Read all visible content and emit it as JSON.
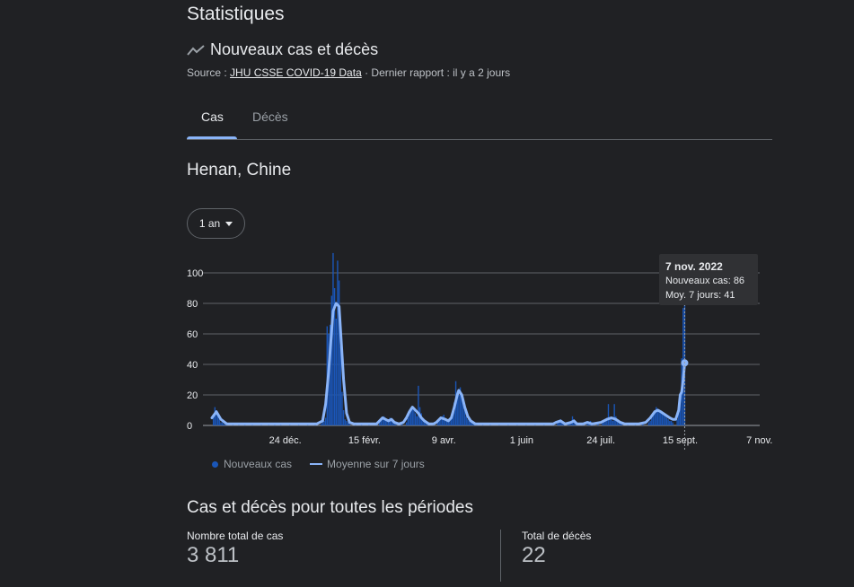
{
  "header": {
    "title": "Statistiques",
    "subtitle": "Nouveaux cas et décès",
    "source_prefix": "Source : ",
    "source_link": "JHU CSSE COVID-19 Data",
    "source_suffix": " · Dernier rapport : il y a 2 jours"
  },
  "tabs": [
    {
      "label": "Cas",
      "selected": true
    },
    {
      "label": "Décès",
      "selected": false
    }
  ],
  "region": "Henan, Chine",
  "period_selector": "1 an",
  "tooltip": {
    "date": "7 nov. 2022",
    "cases_line": "Nouveaux cas: 86",
    "avg_line": "Moy. 7 jours: 41"
  },
  "legend": {
    "cases": "Nouveaux cas",
    "average": "Moyenne sur 7 jours"
  },
  "totals": {
    "title": "Cas et décès pour toutes les périodes",
    "cases_label": "Nombre total de cas",
    "cases_value": "3 811",
    "deaths_label": "Total de décès",
    "deaths_value": "22"
  },
  "colors": {
    "background": "#202124",
    "bar": "#1a56b8",
    "average_line": "#8ab4f8",
    "accent": "#8ab4f8"
  },
  "chart_data": {
    "type": "bar",
    "title": "",
    "xlabel": "",
    "ylabel": "",
    "ylim": [
      0,
      110
    ],
    "yticks": [
      0,
      20,
      40,
      60,
      80,
      100
    ],
    "xtick_labels": [
      "24 déc.",
      "15 févr.",
      "9 avr.",
      "1 juin",
      "24 juil.",
      "15 sept.",
      "7 nov."
    ],
    "xtick_day_index": [
      49,
      102,
      155,
      207,
      260,
      313,
      366
    ],
    "grid": true,
    "legend_position": "bottom",
    "series": [
      {
        "name": "Nouveaux cas",
        "kind": "bar",
        "points": [
          [
            1,
            6
          ],
          [
            2,
            12
          ],
          [
            3,
            10
          ],
          [
            4,
            7
          ],
          [
            5,
            4
          ],
          [
            6,
            2
          ],
          [
            7,
            2
          ],
          [
            8,
            1
          ],
          [
            9,
            1
          ],
          [
            10,
            1
          ],
          [
            14,
            1
          ],
          [
            18,
            1
          ],
          [
            22,
            1
          ],
          [
            27,
            1
          ],
          [
            33,
            1
          ],
          [
            38,
            1
          ],
          [
            42,
            1
          ],
          [
            46,
            1
          ],
          [
            52,
            1
          ],
          [
            58,
            1
          ],
          [
            64,
            1
          ],
          [
            69,
            1
          ],
          [
            73,
            1
          ],
          [
            74,
            2
          ],
          [
            75,
            3
          ],
          [
            76,
            5
          ],
          [
            77,
            65
          ],
          [
            78,
            60
          ],
          [
            79,
            66
          ],
          [
            80,
            85
          ],
          [
            81,
            113
          ],
          [
            82,
            90
          ],
          [
            83,
            70
          ],
          [
            84,
            108
          ],
          [
            85,
            95
          ],
          [
            86,
            52
          ],
          [
            87,
            22
          ],
          [
            88,
            10
          ],
          [
            89,
            4
          ],
          [
            90,
            3
          ],
          [
            91,
            2
          ],
          [
            92,
            1
          ],
          [
            96,
            1
          ],
          [
            100,
            1
          ],
          [
            105,
            1
          ],
          [
            110,
            1
          ],
          [
            112,
            2
          ],
          [
            113,
            3
          ],
          [
            114,
            4
          ],
          [
            115,
            6
          ],
          [
            116,
            5
          ],
          [
            117,
            4
          ],
          [
            118,
            3
          ],
          [
            119,
            5
          ],
          [
            120,
            4
          ],
          [
            121,
            3
          ],
          [
            122,
            2
          ],
          [
            123,
            1
          ],
          [
            127,
            1
          ],
          [
            130,
            2
          ],
          [
            131,
            5
          ],
          [
            132,
            8
          ],
          [
            133,
            10
          ],
          [
            134,
            12
          ],
          [
            135,
            10
          ],
          [
            136,
            8
          ],
          [
            137,
            6
          ],
          [
            138,
            26
          ],
          [
            139,
            12
          ],
          [
            140,
            8
          ],
          [
            141,
            5
          ],
          [
            142,
            3
          ],
          [
            143,
            2
          ],
          [
            144,
            1
          ],
          [
            148,
            1
          ],
          [
            151,
            2
          ],
          [
            152,
            3
          ],
          [
            153,
            5
          ],
          [
            154,
            6
          ],
          [
            155,
            7
          ],
          [
            156,
            5
          ],
          [
            157,
            4
          ],
          [
            158,
            3
          ],
          [
            159,
            4
          ],
          [
            160,
            5
          ],
          [
            161,
            8
          ],
          [
            162,
            15
          ],
          [
            163,
            29
          ],
          [
            164,
            22
          ],
          [
            165,
            20
          ],
          [
            166,
            25
          ],
          [
            167,
            18
          ],
          [
            168,
            15
          ],
          [
            169,
            10
          ],
          [
            170,
            6
          ],
          [
            171,
            4
          ],
          [
            172,
            3
          ],
          [
            173,
            2
          ],
          [
            174,
            2
          ],
          [
            175,
            1
          ],
          [
            176,
            2
          ],
          [
            177,
            1
          ],
          [
            181,
            1
          ],
          [
            186,
            1
          ],
          [
            192,
            1
          ],
          [
            198,
            1
          ],
          [
            204,
            1
          ],
          [
            210,
            1
          ],
          [
            216,
            1
          ],
          [
            222,
            1
          ],
          [
            228,
            1
          ],
          [
            231,
            2
          ],
          [
            232,
            3
          ],
          [
            233,
            4
          ],
          [
            234,
            2
          ],
          [
            235,
            1
          ],
          [
            238,
            1
          ],
          [
            239,
            2
          ],
          [
            240,
            3
          ],
          [
            241,
            6
          ],
          [
            242,
            4
          ],
          [
            243,
            2
          ],
          [
            244,
            1
          ],
          [
            248,
            1
          ],
          [
            251,
            1
          ],
          [
            252,
            2
          ],
          [
            253,
            3
          ],
          [
            254,
            2
          ],
          [
            255,
            1
          ],
          [
            258,
            1
          ],
          [
            261,
            2
          ],
          [
            262,
            3
          ],
          [
            263,
            4
          ],
          [
            264,
            5
          ],
          [
            265,
            14
          ],
          [
            266,
            5
          ],
          [
            267,
            4
          ],
          [
            268,
            3
          ],
          [
            269,
            14
          ],
          [
            270,
            6
          ],
          [
            271,
            4
          ],
          [
            272,
            2
          ],
          [
            273,
            2
          ],
          [
            274,
            1
          ],
          [
            278,
            1
          ],
          [
            283,
            1
          ],
          [
            288,
            1
          ],
          [
            292,
            2
          ],
          [
            293,
            3
          ],
          [
            294,
            5
          ],
          [
            295,
            8
          ],
          [
            296,
            10
          ],
          [
            297,
            12
          ],
          [
            298,
            11
          ],
          [
            299,
            10
          ],
          [
            300,
            9
          ],
          [
            301,
            8
          ],
          [
            302,
            7
          ],
          [
            303,
            6
          ],
          [
            304,
            5
          ],
          [
            305,
            4
          ],
          [
            306,
            3
          ],
          [
            307,
            3
          ],
          [
            308,
            2
          ],
          [
            311,
            4
          ],
          [
            312,
            8
          ],
          [
            313,
            20
          ],
          [
            314,
            44
          ],
          [
            315,
            77
          ],
          [
            316,
            86
          ]
        ]
      },
      {
        "name": "Moyenne sur 7 jours",
        "kind": "line",
        "points": [
          [
            0,
            5
          ],
          [
            3,
            9
          ],
          [
            6,
            4
          ],
          [
            10,
            1
          ],
          [
            20,
            1
          ],
          [
            40,
            1
          ],
          [
            60,
            1
          ],
          [
            70,
            1
          ],
          [
            74,
            3
          ],
          [
            76,
            14
          ],
          [
            78,
            35
          ],
          [
            80,
            62
          ],
          [
            81,
            75
          ],
          [
            83,
            80
          ],
          [
            85,
            78
          ],
          [
            86,
            62
          ],
          [
            88,
            30
          ],
          [
            90,
            8
          ],
          [
            92,
            2
          ],
          [
            95,
            1
          ],
          [
            110,
            1
          ],
          [
            112,
            3
          ],
          [
            114,
            5
          ],
          [
            116,
            4
          ],
          [
            118,
            3
          ],
          [
            120,
            4
          ],
          [
            122,
            2
          ],
          [
            125,
            1
          ],
          [
            128,
            2
          ],
          [
            130,
            5
          ],
          [
            132,
            9
          ],
          [
            134,
            12
          ],
          [
            136,
            10
          ],
          [
            138,
            8
          ],
          [
            140,
            5
          ],
          [
            142,
            3
          ],
          [
            145,
            1
          ],
          [
            148,
            1
          ],
          [
            150,
            2
          ],
          [
            153,
            5
          ],
          [
            156,
            4
          ],
          [
            158,
            3
          ],
          [
            160,
            5
          ],
          [
            162,
            12
          ],
          [
            164,
            20
          ],
          [
            165,
            23
          ],
          [
            167,
            20
          ],
          [
            169,
            12
          ],
          [
            171,
            6
          ],
          [
            173,
            3
          ],
          [
            176,
            1
          ],
          [
            180,
            1
          ],
          [
            200,
            1
          ],
          [
            220,
            1
          ],
          [
            228,
            1
          ],
          [
            230,
            2
          ],
          [
            233,
            3
          ],
          [
            236,
            1
          ],
          [
            240,
            2
          ],
          [
            242,
            3
          ],
          [
            244,
            1
          ],
          [
            248,
            1
          ],
          [
            251,
            2
          ],
          [
            254,
            1
          ],
          [
            260,
            2
          ],
          [
            264,
            4
          ],
          [
            267,
            5
          ],
          [
            270,
            4
          ],
          [
            273,
            2
          ],
          [
            276,
            1
          ],
          [
            285,
            1
          ],
          [
            290,
            2
          ],
          [
            293,
            5
          ],
          [
            296,
            9
          ],
          [
            298,
            10
          ],
          [
            300,
            9
          ],
          [
            303,
            7
          ],
          [
            306,
            5
          ],
          [
            308,
            4
          ],
          [
            310,
            4
          ],
          [
            312,
            10
          ],
          [
            313,
            20
          ],
          [
            314,
            22
          ],
          [
            315,
            30
          ],
          [
            316,
            41
          ]
        ]
      }
    ]
  }
}
